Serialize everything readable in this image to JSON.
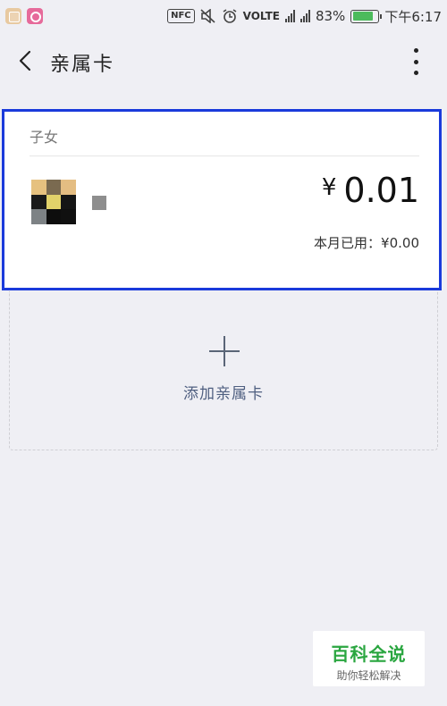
{
  "status_bar": {
    "nfc": "NFC",
    "volte": "VOLTE",
    "battery": "83%",
    "battery_level": 0.83,
    "time": "下午6:17"
  },
  "nav": {
    "title": "亲属卡"
  },
  "card": {
    "relation": "子女",
    "currency": "¥",
    "amount": "0.01",
    "used_this_month": "本月已用：¥0.00"
  },
  "add_card": {
    "label": "添加亲属卡"
  },
  "watermark": {
    "title": "百科全说",
    "subtitle": "助你轻松解决"
  },
  "colors": {
    "selection_border": "#1a3adb",
    "battery_fill": "#4cbb5c",
    "watermark_green": "#2aa640",
    "add_label": "#4f5f80"
  }
}
